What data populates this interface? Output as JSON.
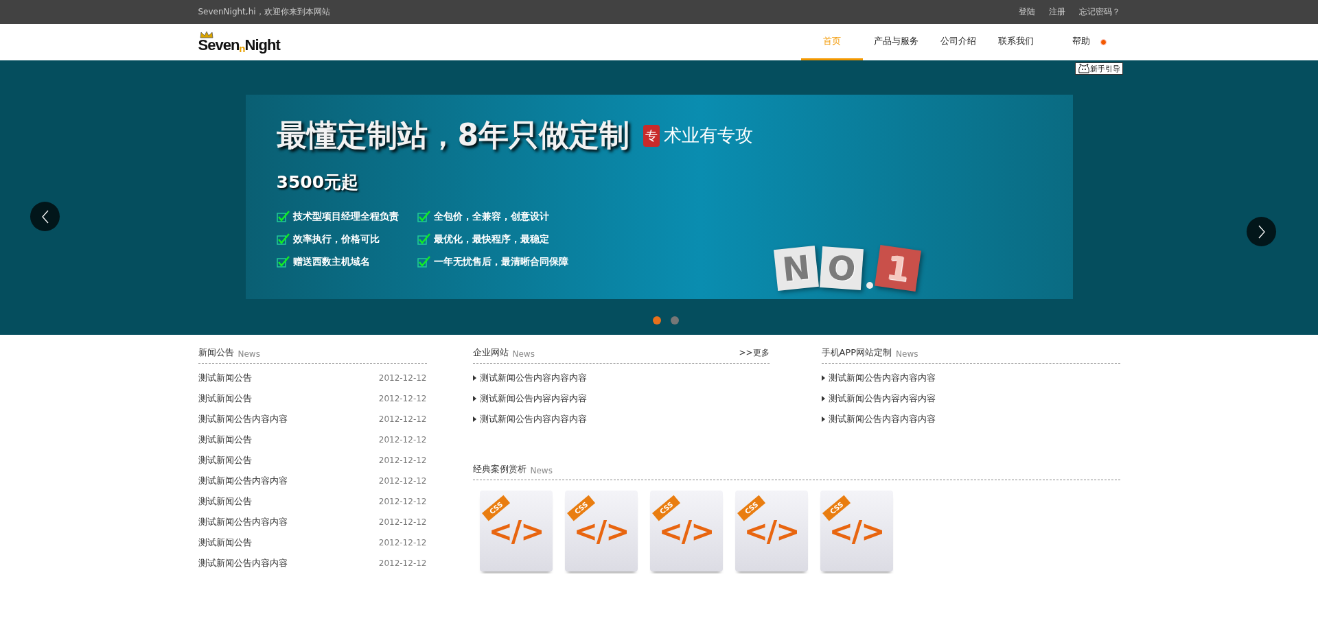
{
  "top_bar": {
    "greeting": "SevenNight,hi，欢迎你来到本网站",
    "links": [
      "登陆",
      "注册",
      "忘记密码？"
    ]
  },
  "header": {
    "logo": {
      "part_1": "Seven",
      "part_2": "n",
      "part_3": "Night"
    },
    "nav": [
      {
        "label": "首页",
        "selected": true
      },
      {
        "label": "产品与服务",
        "selected": false
      },
      {
        "label": "公司介绍",
        "selected": false
      },
      {
        "label": "联系我们",
        "selected": false
      },
      {
        "label": "帮助",
        "selected": false
      }
    ],
    "guide_tag": "新手引导"
  },
  "banner": {
    "title": "最懂定制站，8年只做定制",
    "seal": "专",
    "motto": "术业有专攻",
    "price": "3500元起",
    "features": [
      "技术型项目经理全程负责",
      "全包价，全兼容，创意设计",
      "效率执行，价格可比",
      "最优化，最快程序，最稳定",
      "赠送西数主机域名",
      "一年无忧售后，最清晰合同保障"
    ],
    "badge": {
      "letters": [
        "N",
        "O"
      ],
      "number": "1"
    },
    "dots": [
      {
        "selected": true
      },
      {
        "selected": false
      }
    ]
  },
  "news": {
    "title": "新闻公告",
    "subtitle": "News",
    "items": [
      {
        "text": "测试新闻公告",
        "date": "2012-12-12"
      },
      {
        "text": "测试新闻公告",
        "date": "2012-12-12"
      },
      {
        "text": "测试新闻公告内容内容",
        "date": "2012-12-12"
      },
      {
        "text": "测试新闻公告",
        "date": "2012-12-12"
      },
      {
        "text": "测试新闻公告",
        "date": "2012-12-12"
      },
      {
        "text": "测试新闻公告内容内容",
        "date": "2012-12-12"
      },
      {
        "text": "测试新闻公告",
        "date": "2012-12-12"
      },
      {
        "text": "测试新闻公告内容内容",
        "date": "2012-12-12"
      },
      {
        "text": "测试新闻公告",
        "date": "2012-12-12"
      },
      {
        "text": "测试新闻公告内容内容",
        "date": "2012-12-12"
      }
    ]
  },
  "enterprise": {
    "title": "企业网站",
    "subtitle": "News",
    "more": ">>更多",
    "items": [
      "测试新闻公告内容内容内容",
      "测试新闻公告内容内容内容",
      "测试新闻公告内容内容内容"
    ]
  },
  "mobile_app": {
    "title": "手机APP网站定制",
    "subtitle": "News",
    "items": [
      "测试新闻公告内容内容内容",
      "测试新闻公告内容内容内容",
      "测试新闻公告内容内容内容"
    ]
  },
  "cases": {
    "title": "经典案例赏析",
    "subtitle": "News",
    "items": [
      {
        "ribbon": "CSS",
        "code": "</>"
      },
      {
        "ribbon": "CSS",
        "code": "</>"
      },
      {
        "ribbon": "CSS",
        "code": "</>"
      },
      {
        "ribbon": "CSS",
        "code": "</>"
      },
      {
        "ribbon": "CSS",
        "code": "</>"
      }
    ]
  }
}
